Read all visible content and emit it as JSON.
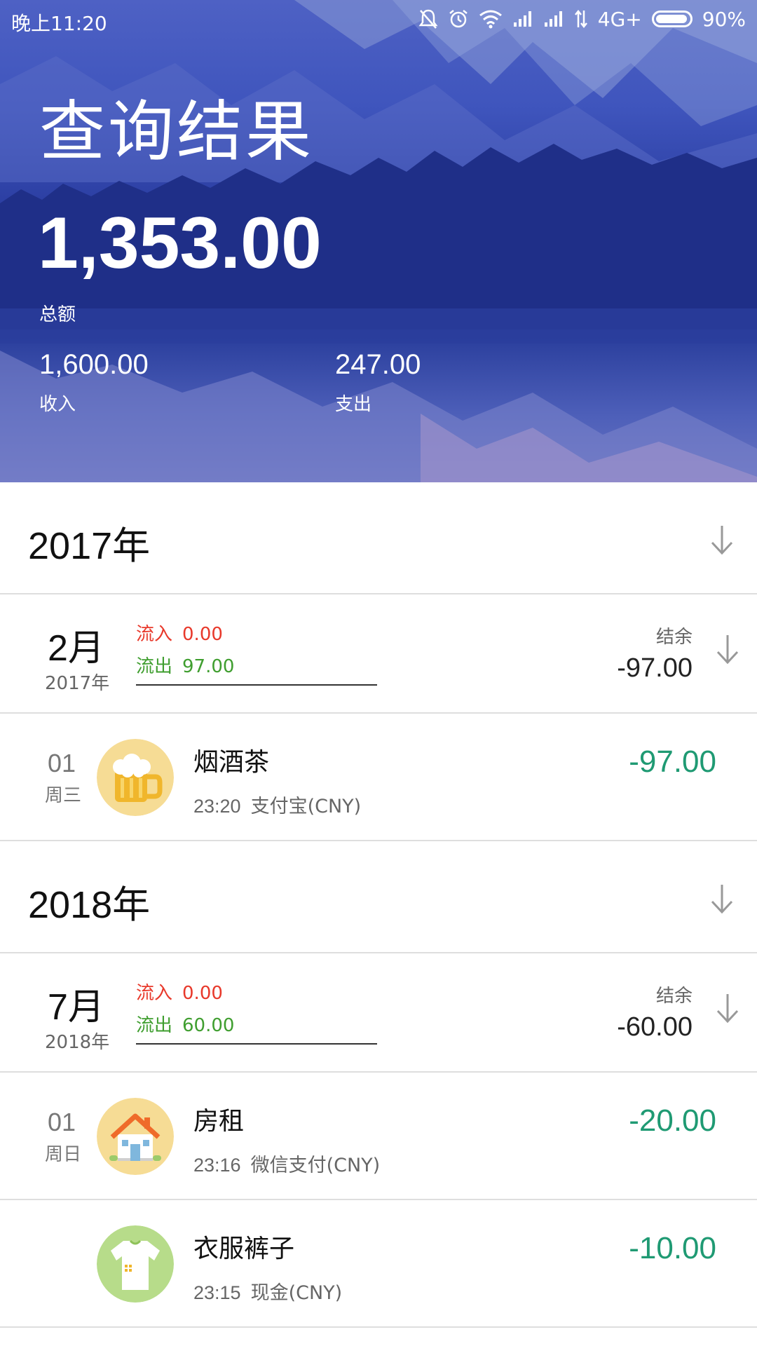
{
  "status_bar": {
    "time": "晚上11:20",
    "network": "4G+",
    "battery": "90%"
  },
  "header": {
    "title": "查询结果",
    "total_amount": "1,353.00",
    "total_label": "总额",
    "income_amount": "1,600.00",
    "income_label": "收入",
    "expense_amount": "247.00",
    "expense_label": "支出"
  },
  "groups": [
    {
      "year": "2017年",
      "month": {
        "month": "2月",
        "year": "2017年",
        "inflow_label": "流入",
        "inflow_value": "0.00",
        "outflow_label": "流出",
        "outflow_value": "97.00",
        "balance_label": "结余",
        "balance_value": "-97.00"
      },
      "transactions": [
        {
          "day": "01",
          "weekday": "周三",
          "icon": "beer-icon",
          "title": "烟酒茶",
          "time": "23:20",
          "account": "支付宝(CNY)",
          "amount": "-97.00"
        }
      ]
    },
    {
      "year": "2018年",
      "month": {
        "month": "7月",
        "year": "2018年",
        "inflow_label": "流入",
        "inflow_value": "0.00",
        "outflow_label": "流出",
        "outflow_value": "60.00",
        "balance_label": "结余",
        "balance_value": "-60.00"
      },
      "transactions": [
        {
          "day": "01",
          "weekday": "周日",
          "icon": "house-icon",
          "title": "房租",
          "time": "23:16",
          "account": "微信支付(CNY)",
          "amount": "-20.00"
        },
        {
          "day": "",
          "weekday": "",
          "icon": "shirt-icon",
          "title": "衣服裤子",
          "time": "23:15",
          "account": "现金(CNY)",
          "amount": "-10.00"
        }
      ]
    }
  ],
  "colors": {
    "header_blue": "#2c3fa3",
    "inflow_red": "#e8392b",
    "outflow_green": "#3f9e2f",
    "amount_teal": "#1f9a73"
  }
}
